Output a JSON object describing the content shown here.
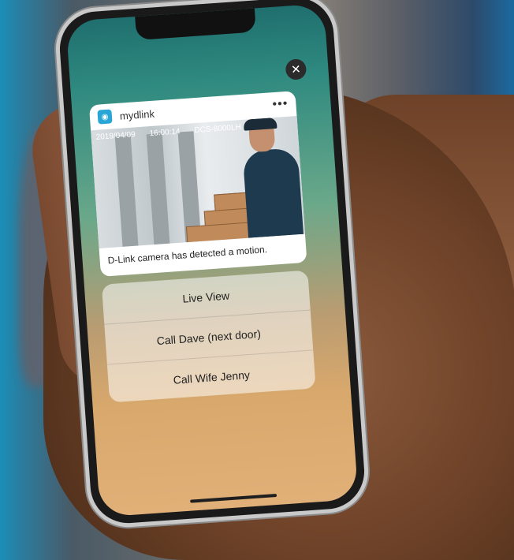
{
  "notification": {
    "app_name": "mydlink",
    "more_icon": "more-icon",
    "close_icon": "close-icon",
    "camera": {
      "date": "2019/04/09",
      "time": "16:00:14",
      "camera_id": "DCS-8000LH"
    },
    "message": "D-Link camera has detected a motion."
  },
  "actions": [
    {
      "label": "Live View"
    },
    {
      "label": "Call Dave (next door)"
    },
    {
      "label": "Call Wife Jenny"
    }
  ],
  "colors": {
    "app_icon": "#2aa6d6",
    "close_button": "#2b2b2b"
  }
}
